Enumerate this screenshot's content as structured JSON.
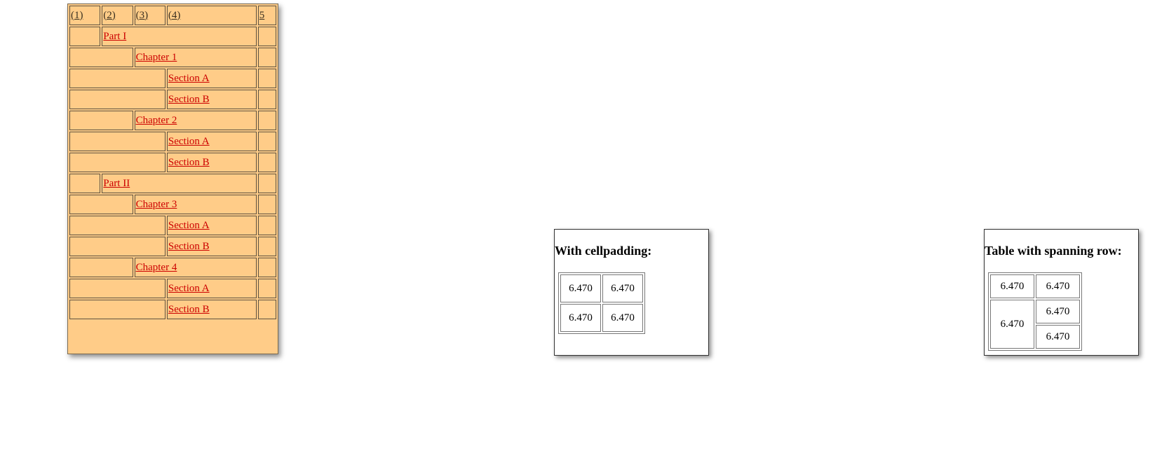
{
  "outline": {
    "header": [
      "(1)",
      "(2)",
      "(3)",
      "(4)",
      "5"
    ],
    "part_1": "Part I",
    "chapter_1": "Chapter 1",
    "ch1_section_a": "Section A",
    "ch1_section_b": "Section B",
    "chapter_2": "Chapter 2",
    "ch2_section_a": "Section A",
    "ch2_section_b": "Section B",
    "part_2": "Part II",
    "chapter_3": "Chapter 3",
    "ch3_section_a": "Section A",
    "ch3_section_b": "Section B",
    "chapter_4": "Chapter 4",
    "ch4_section_a": "Section A",
    "ch4_section_b": "Section B",
    "colors": {
      "background": "#ffcc88",
      "link": "#cc0000"
    }
  },
  "cellpadding_box": {
    "title": "With cellpadding:",
    "cells": [
      "6.470",
      "6.470",
      "6.470",
      "6.470"
    ]
  },
  "spanning_box": {
    "title": "Table with spanning row:",
    "cells": [
      "6.470",
      "6.470",
      "6.470",
      "6.470",
      "6.470"
    ]
  }
}
